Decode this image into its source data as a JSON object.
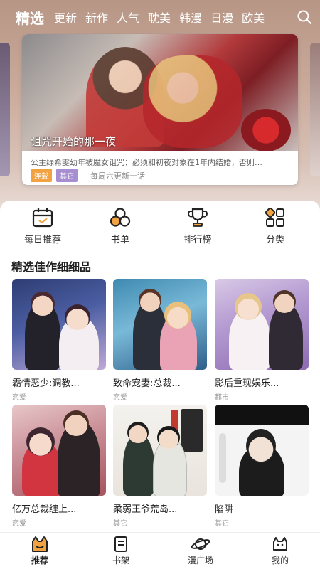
{
  "topnav": {
    "tabs": [
      "精选",
      "更新",
      "新作",
      "人气",
      "耽美",
      "韩漫",
      "日漫",
      "欧美"
    ],
    "active_index": 0
  },
  "banner": {
    "title": "诅咒开始的那一夜",
    "description": "公主绿希雯幼年被魔女诅咒：必须和初夜对象在1年内结婚，否则…",
    "tags": [
      "连载",
      "其它"
    ],
    "schedule": "每周六更新一话"
  },
  "quick_nav": [
    {
      "label": "每日推荐",
      "icon": "calendar-icon"
    },
    {
      "label": "书单",
      "icon": "circles-icon"
    },
    {
      "label": "排行榜",
      "icon": "trophy-icon"
    },
    {
      "label": "分类",
      "icon": "grid-icon"
    }
  ],
  "section": {
    "title": "精选佳作细细品",
    "items": [
      {
        "title": "霸情恶少:调教...",
        "genre": "恋爱"
      },
      {
        "title": "致命宠妻:总裁...",
        "genre": "恋爱"
      },
      {
        "title": "影后重现娱乐...",
        "genre": "都市"
      },
      {
        "title": "亿万总裁缠上...",
        "genre": "恋爱"
      },
      {
        "title": "柔弱王爷荒岛...",
        "genre": "其它"
      },
      {
        "title": "陷阱",
        "genre": "其它"
      }
    ]
  },
  "tabbar": [
    {
      "label": "推荐",
      "icon": "home-cat-icon"
    },
    {
      "label": "书架",
      "icon": "bookshelf-icon"
    },
    {
      "label": "漫广场",
      "icon": "planet-icon"
    },
    {
      "label": "我的",
      "icon": "profile-cat-icon"
    }
  ],
  "colors": {
    "accent_orange": "#f2a241",
    "accent_purple": "#a68ed0"
  }
}
